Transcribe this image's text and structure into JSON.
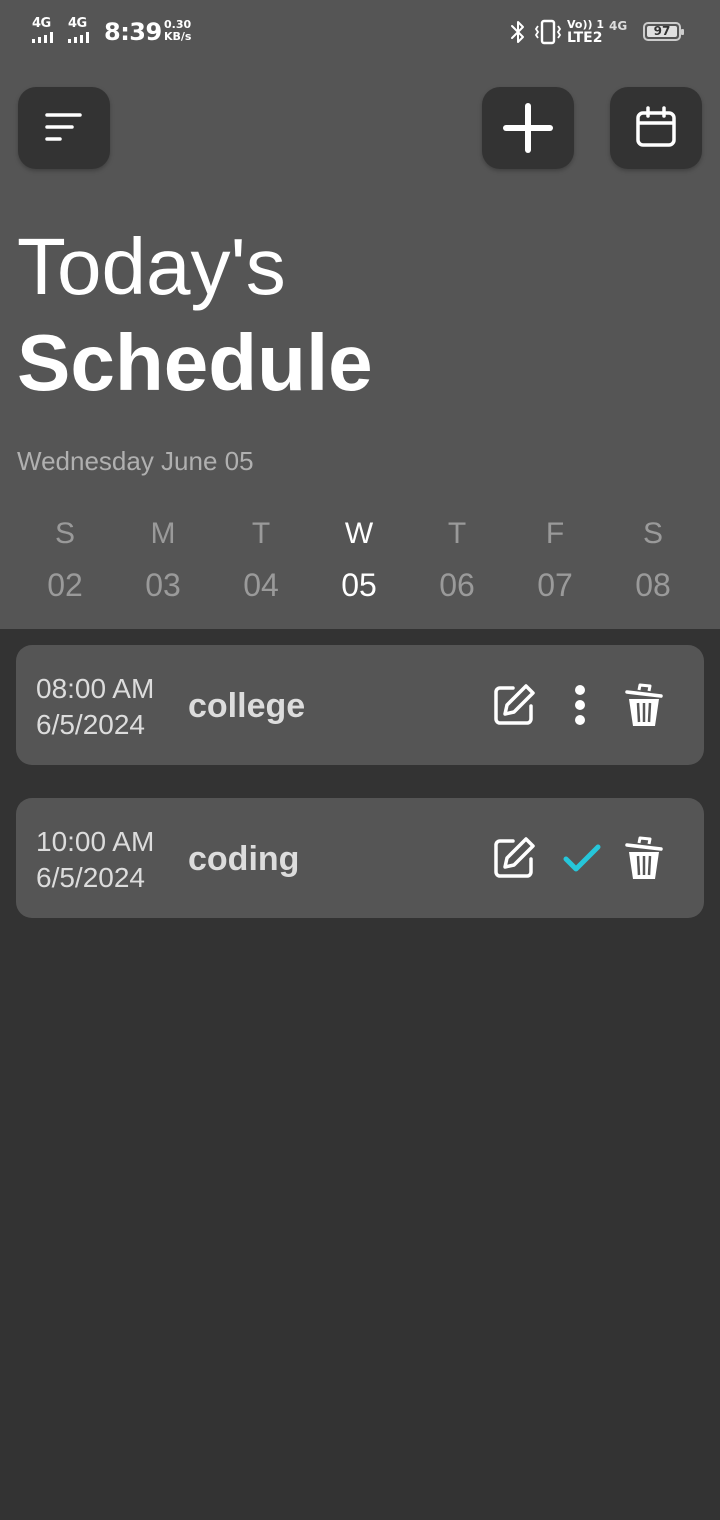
{
  "status_bar": {
    "sim1_network": "4G",
    "sim2_network": "4G",
    "time": "8:39",
    "speed_value": "0.30",
    "speed_unit": "KB/s",
    "volte_line1": "Vo)) 1",
    "volte_line2": "LTE2",
    "network_right": "4G",
    "battery_level": "97"
  },
  "header": {
    "title_line1": "Today's",
    "title_line2": "Schedule",
    "current_date": "Wednesday June 05"
  },
  "week": [
    {
      "day": "S",
      "date": "02",
      "selected": false
    },
    {
      "day": "M",
      "date": "03",
      "selected": false
    },
    {
      "day": "T",
      "date": "04",
      "selected": false
    },
    {
      "day": "W",
      "date": "05",
      "selected": true
    },
    {
      "day": "T",
      "date": "06",
      "selected": false
    },
    {
      "day": "F",
      "date": "07",
      "selected": false
    },
    {
      "day": "S",
      "date": "08",
      "selected": false
    }
  ],
  "tasks": [
    {
      "time": "08:00 AM",
      "date": "6/5/2024",
      "name": "college",
      "status_icon": "more-vertical-icon"
    },
    {
      "time": "10:00 AM",
      "date": "6/5/2024",
      "name": "coding",
      "status_icon": "check-icon"
    }
  ],
  "colors": {
    "header_bg": "#555555",
    "page_bg": "#333333",
    "button_bg": "#333333",
    "card_bg": "#555555",
    "check_accent": "#26c6da",
    "muted_text": "#9a9a9a"
  }
}
